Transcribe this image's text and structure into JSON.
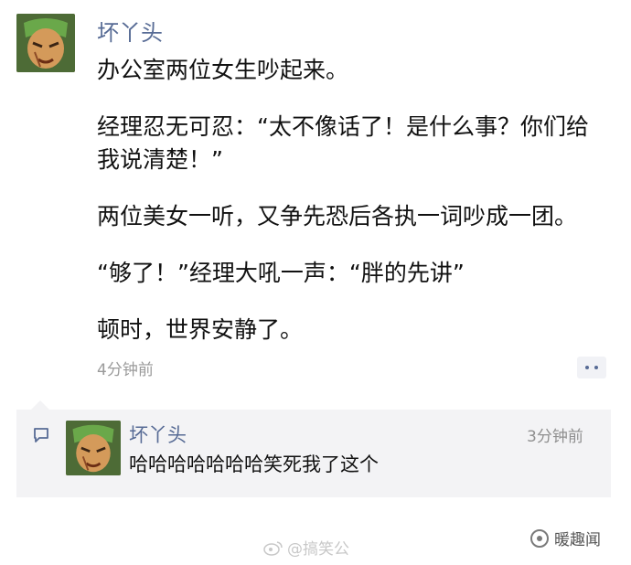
{
  "post": {
    "author": "坏丫头",
    "lines": [
      "办公室两位女生吵起来。",
      "经理忍无可忍：“太不像话了！是什么事？你们给我说清楚！”",
      "两位美女一听，又争先恐后各执一词吵成一团。",
      "“够了！”经理大吼一声：“胖的先讲”",
      "顿时，世界安静了。"
    ],
    "time": "4分钟前"
  },
  "comment": {
    "author": "坏丫头",
    "time": "3分钟前",
    "text": "哈哈哈哈哈哈哈笑死我了这个"
  },
  "watermarks": {
    "center": "@搞笑公",
    "right": "暖趣闻"
  },
  "colors": {
    "link": "#576b95",
    "comment_bg": "#f3f3f5",
    "meta_text": "#9b9b9b"
  },
  "icons": {
    "more": "more-dots-icon",
    "comment": "comment-bubble-icon",
    "weibo": "weibo-icon",
    "brand": "brand-circle-icon"
  }
}
